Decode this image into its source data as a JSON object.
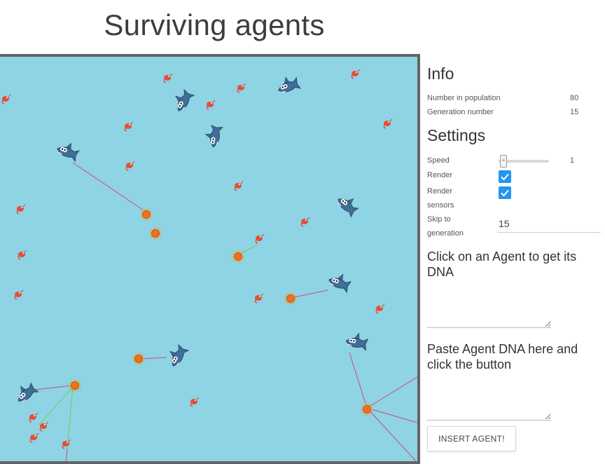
{
  "title": "Surviving agents",
  "info": {
    "heading": "Info",
    "population_label": "Number in population",
    "population_value": "80",
    "generation_label": "Generation number",
    "generation_value": "15"
  },
  "settings": {
    "heading": "Settings",
    "speed_label": "Speed",
    "speed_value": "1",
    "render_label": "Render",
    "render_checked": true,
    "render_sensors_label_1": "Render",
    "render_sensors_label_2": "sensors",
    "render_sensors_checked": true,
    "skip_label_1": "Skip to",
    "skip_label_2": "generation",
    "skip_value": "15"
  },
  "dna": {
    "get_text": "Click on an Agent to get its DNA",
    "paste_text": "Paste Agent DNA here and click the button",
    "insert_button": "INSERT AGENT!"
  },
  "colors": {
    "water": "#8ed4e4",
    "frame": "#646464",
    "accent": "#2196f3",
    "sensor_red": "#d4477a",
    "sensor_green": "#5fd45a",
    "shark": "#3f6e98",
    "shrimp": "#e0503c",
    "urchin": "#f07020"
  }
}
